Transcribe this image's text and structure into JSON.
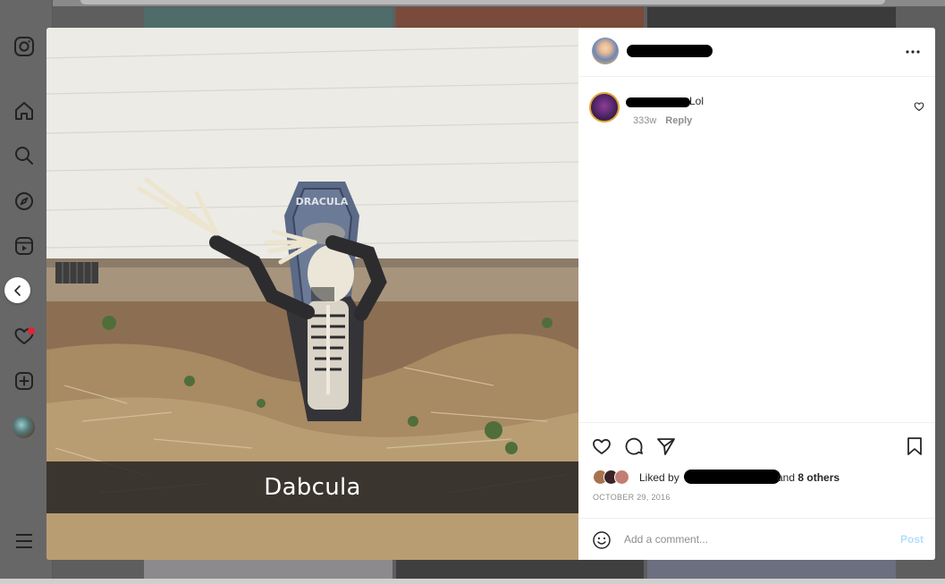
{
  "post": {
    "caption_overlay": "Dabcula",
    "image_alt": "Skeleton dabbing in front of a Dracula coffin decoration"
  },
  "comment": {
    "text": "Lol",
    "age": "333w",
    "reply_label": "Reply"
  },
  "likes": {
    "prefix": "Liked by",
    "suffix": "and",
    "others": "8 others"
  },
  "date": "OCTOBER 29, 2016",
  "composer": {
    "placeholder": "Add a comment...",
    "post_label": "Post"
  },
  "colors": {
    "post_disabled": "#b2dffc",
    "notification": "#e0243a",
    "story_ring": "#e2a33c"
  },
  "icons": [
    "instagram-icon",
    "home-icon",
    "search-icon",
    "explore-icon",
    "reels-icon",
    "heart-icon",
    "create-icon",
    "menu-icon",
    "chevron-left-icon",
    "more-icon",
    "like-icon",
    "comment-icon",
    "share-icon",
    "save-icon",
    "emoji-icon"
  ]
}
